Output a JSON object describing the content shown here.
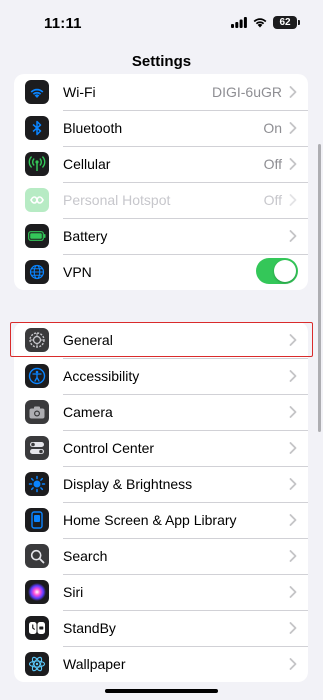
{
  "status_bar": {
    "time": "11:11",
    "battery_level": "62"
  },
  "nav": {
    "title": "Settings"
  },
  "groups": [
    {
      "rows": [
        {
          "label": "Wi-Fi",
          "value": "DIGI-6uGR",
          "icon": "wifi-icon"
        },
        {
          "label": "Bluetooth",
          "value": "On",
          "icon": "bluetooth-icon"
        },
        {
          "label": "Cellular",
          "value": "Off",
          "icon": "cellular-icon"
        },
        {
          "label": "Personal Hotspot",
          "value": "Off",
          "icon": "hotspot-icon",
          "disabled": true
        },
        {
          "label": "Battery",
          "value": "",
          "icon": "battery-icon"
        },
        {
          "label": "VPN",
          "toggle": true,
          "toggle_on": true,
          "icon": "vpn-icon"
        }
      ]
    },
    {
      "rows": [
        {
          "label": "General",
          "icon": "gear-icon",
          "highlighted": true
        },
        {
          "label": "Accessibility",
          "icon": "accessibility-icon"
        },
        {
          "label": "Camera",
          "icon": "camera-icon"
        },
        {
          "label": "Control Center",
          "icon": "control-center-icon"
        },
        {
          "label": "Display & Brightness",
          "icon": "brightness-icon"
        },
        {
          "label": "Home Screen & App Library",
          "icon": "home-screen-icon"
        },
        {
          "label": "Search",
          "icon": "search-icon"
        },
        {
          "label": "Siri",
          "icon": "siri-icon"
        },
        {
          "label": "StandBy",
          "icon": "standby-icon"
        },
        {
          "label": "Wallpaper",
          "icon": "wallpaper-icon"
        }
      ]
    }
  ],
  "colors": {
    "toggle_on": "#34c759",
    "highlight_border": "#d92b2b",
    "icon_bg": "#1c1c1e",
    "accent_blue": "#0a84ff"
  }
}
